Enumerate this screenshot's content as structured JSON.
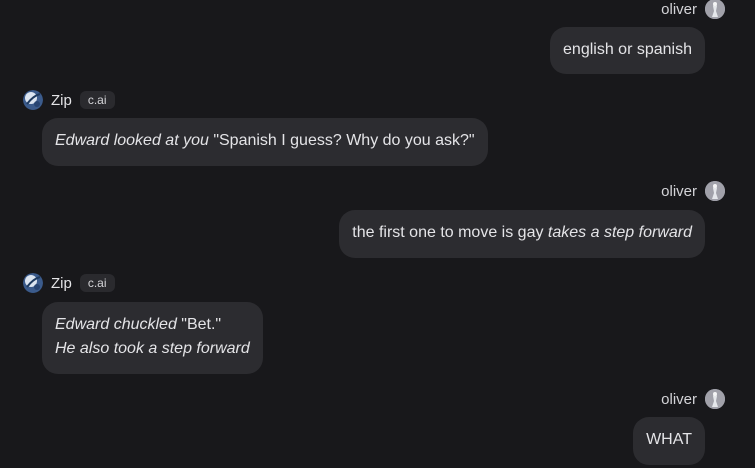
{
  "user": {
    "name": "oliver"
  },
  "bot": {
    "name": "Zip",
    "badge": "c.ai"
  },
  "messages": [
    {
      "role": "user",
      "parts": [
        {
          "text": "english or spanish",
          "italic": false
        }
      ]
    },
    {
      "role": "bot",
      "parts": [
        {
          "text": "Edward looked at you",
          "italic": true
        },
        {
          "text": " \"Spanish I guess? Why do you ask?\"",
          "italic": false
        }
      ]
    },
    {
      "role": "user",
      "parts": [
        {
          "text": "the first one to move is gay ",
          "italic": false
        },
        {
          "text": "takes a step forward",
          "italic": true
        }
      ]
    },
    {
      "role": "bot",
      "parts": [
        {
          "text": "Edward chuckled",
          "italic": true
        },
        {
          "text": " \"Bet.\"",
          "italic": false
        },
        {
          "text": "He also took a step forward",
          "italic": true
        }
      ]
    },
    {
      "role": "user",
      "parts": [
        {
          "text": "WHAT",
          "italic": false
        }
      ]
    }
  ]
}
